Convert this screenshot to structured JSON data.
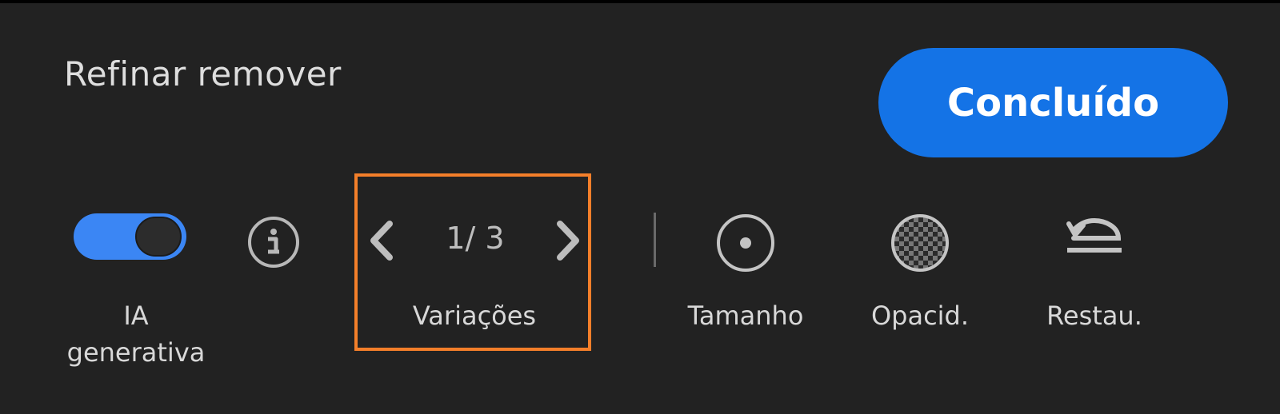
{
  "header": {
    "title": "Refinar remover",
    "done_label": "Concluído"
  },
  "toolbar": {
    "generative_ai": {
      "label_line1": "IA",
      "label_line2": "generativa",
      "enabled": true
    },
    "info_icon": "info-icon",
    "variations": {
      "label": "Variações",
      "counter": "1/ 3",
      "current": 1,
      "total": 3
    },
    "size": {
      "label": "Tamanho",
      "icon": "brush-size-icon"
    },
    "opacity": {
      "label": "Opacid.",
      "icon": "opacity-checker-icon"
    },
    "restore": {
      "label": "Restau.",
      "icon": "undo-icon"
    }
  },
  "colors": {
    "background": "#222222",
    "accent": "#1473e6",
    "toggle_on": "#3b86f4",
    "highlight": "#f47f2a"
  }
}
